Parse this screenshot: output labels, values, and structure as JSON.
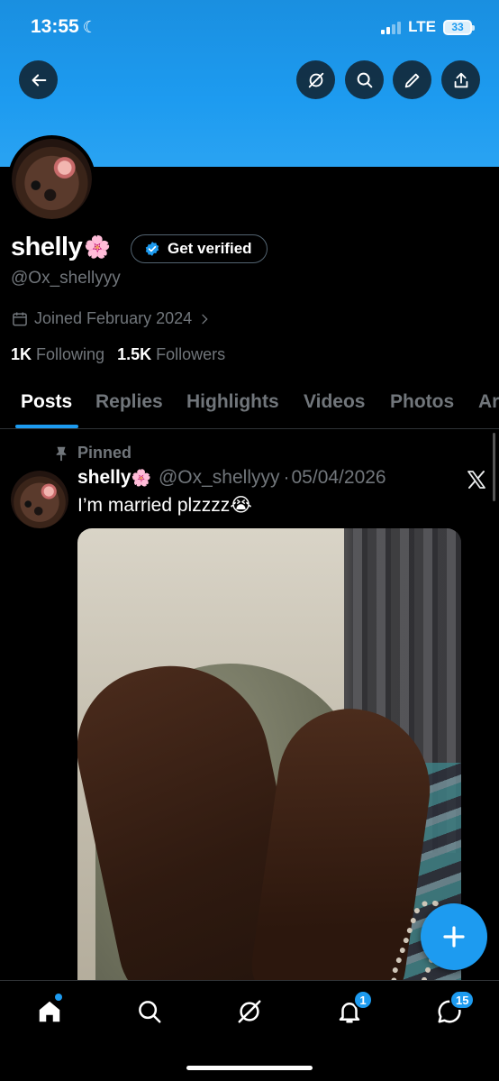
{
  "status_bar": {
    "time": "13:55",
    "network": "LTE",
    "battery": "33"
  },
  "profile": {
    "name": "shelly",
    "name_emoji": "🌸",
    "verify_label": "Get verified",
    "handle": "@Ox_shellyyy",
    "joined": "Joined February 2024",
    "following_count": "1K",
    "following_label": "Following",
    "followers_count": "1.5K",
    "followers_label": "Followers"
  },
  "tabs": [
    {
      "label": "Posts"
    },
    {
      "label": "Replies"
    },
    {
      "label": "Highlights"
    },
    {
      "label": "Videos"
    },
    {
      "label": "Photos"
    },
    {
      "label": "Ar"
    }
  ],
  "post": {
    "pinned_label": "Pinned",
    "author": "shelly",
    "author_emoji": "🌸",
    "handle": "@Ox_shellyyy",
    "separator": "·",
    "date": "05/04/2026",
    "text": "I’m married plzzzz😭"
  },
  "bottom_nav": {
    "notifications_count": "1",
    "messages_count": "15"
  },
  "colors": {
    "accent": "#1d9bf0",
    "background": "#000000",
    "secondary_text": "#71767b",
    "divider": "#2f3336"
  },
  "icons": [
    "back-arrow-icon",
    "grok-icon",
    "search-icon",
    "edit-pencil-icon",
    "share-icon",
    "verified-badge-icon",
    "calendar-icon",
    "chevron-right-icon",
    "pin-icon",
    "x-logo-icon",
    "plus-icon",
    "home-icon",
    "bell-icon",
    "messages-icon"
  ]
}
